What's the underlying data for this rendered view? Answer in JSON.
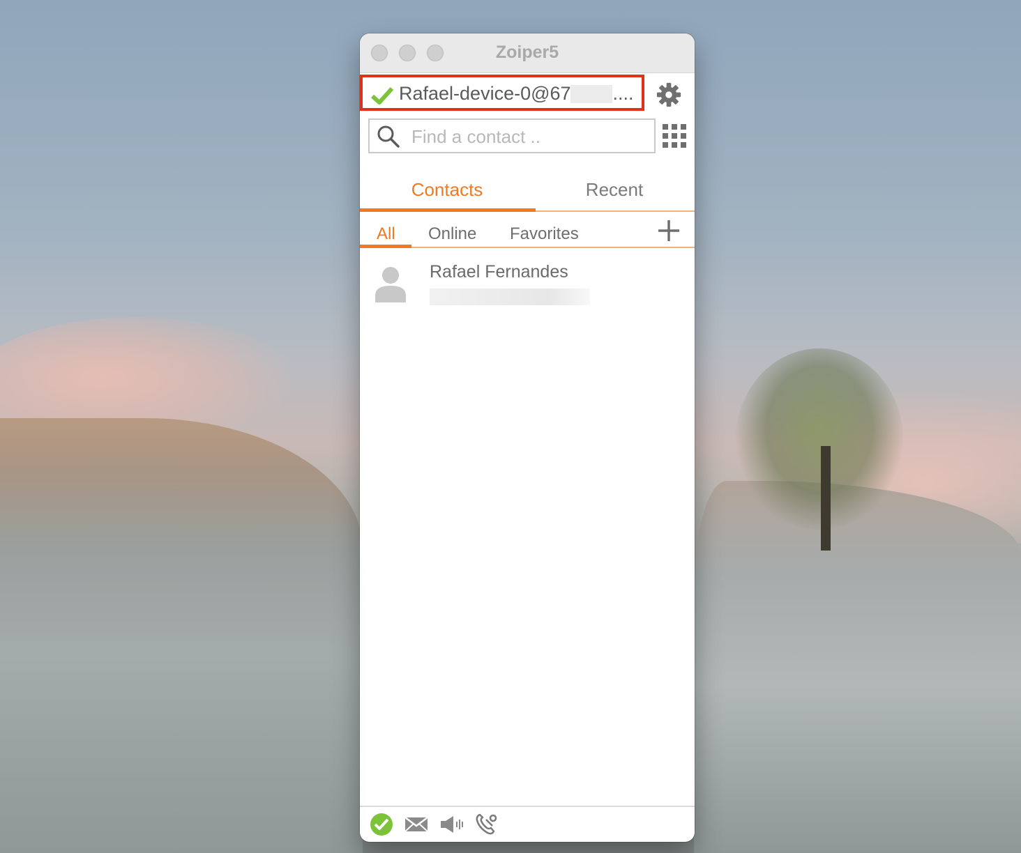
{
  "window": {
    "title": "Zoiper5"
  },
  "account": {
    "name": "Rafael-device-0@67",
    "ellipsis": "....",
    "status_color": "#7dc33a",
    "highlight_color": "#e0321b"
  },
  "search": {
    "placeholder": "Find a contact .."
  },
  "tabs": [
    {
      "label": "Contacts",
      "active": true
    },
    {
      "label": "Recent",
      "active": false
    }
  ],
  "filters": [
    {
      "label": "All",
      "active": true
    },
    {
      "label": "Online",
      "active": false
    },
    {
      "label": "Favorites",
      "active": false
    }
  ],
  "contacts": [
    {
      "name": "Rafael Fernandes"
    }
  ],
  "statusbar": {
    "icons": [
      "status-online-icon",
      "mail-icon",
      "speaker-icon",
      "phone-settings-icon"
    ]
  },
  "theme": {
    "accent": "#ef7a23"
  }
}
